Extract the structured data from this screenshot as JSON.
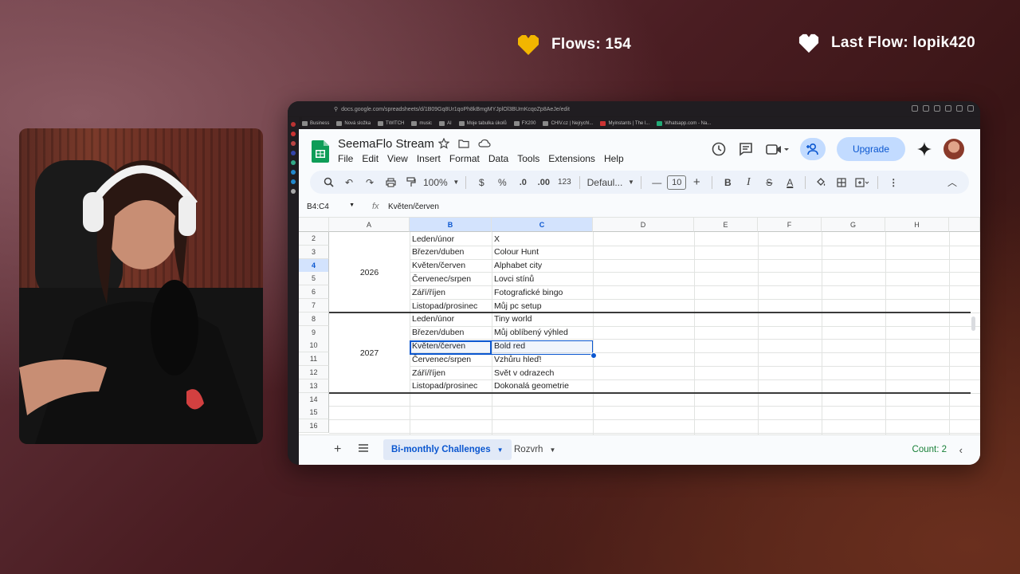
{
  "overlay": {
    "flows": "Flows: 154",
    "last_flow": "Last Flow: lopik420",
    "heart_gold": "#f2b600",
    "heart_white": "#ffffff"
  },
  "browser": {
    "url": "docs.google.com/spreadsheets/d/1B09Gq8Ur1qoPh8kBmgMYJplOl3BUmKcqoZp8AeJe/edit",
    "bookmarks": [
      "Business",
      "Nová složka",
      "TWITCH",
      "music",
      "AI",
      "Moje tabulka úkolů",
      "FX200",
      "CHIV.cz | Nejrychl...",
      "Myinstants | The l...",
      "Whatsapp.com - Na..."
    ]
  },
  "sheets": {
    "doc_title": "SeemaFlo Stream",
    "menus": [
      "File",
      "Edit",
      "View",
      "Insert",
      "Format",
      "Data",
      "Tools",
      "Extensions",
      "Help"
    ],
    "upgrade_label": "Upgrade",
    "zoom": "100%",
    "currency": "$",
    "percent": "%",
    "dec_decrease": ".0",
    "dec_increase": ".00",
    "number_format": "123",
    "font_family": "Defaul...",
    "font_size": "10",
    "namebox": "B4:C4",
    "fx": "fx",
    "formula": "Květen/červen",
    "columns": [
      "A",
      "B",
      "C",
      "D",
      "E",
      "F",
      "G",
      "H"
    ],
    "rows": [
      "2",
      "3",
      "4",
      "5",
      "6",
      "7",
      "8",
      "9",
      "10",
      "11",
      "12",
      "13",
      "14",
      "15",
      "16"
    ],
    "years": [
      "2026",
      "2027"
    ],
    "col_b": [
      "Leden/únor",
      "Březen/duben",
      "Květen/červen",
      "Červenec/srpen",
      "Září/říjen",
      "Listopad/prosinec",
      "Leden/únor",
      "Březen/duben",
      "Květen/červen",
      "Červenec/srpen",
      "Září/říjen",
      "Listopad/prosinec"
    ],
    "col_c": [
      "X",
      "Colour Hunt",
      "Alphabet city",
      "Lovci stínů",
      "Fotografické bingo",
      "Můj pc setup",
      "Tiny world",
      "Můj oblíbený výhled",
      "Bold red",
      "Vzhůru hleď!",
      "Svět v odrazech",
      "Dokonalá geometrie"
    ],
    "sheet_tabs": [
      "Bi-monthly Challenges",
      "Rozvrh"
    ],
    "count": "Count: 2"
  }
}
